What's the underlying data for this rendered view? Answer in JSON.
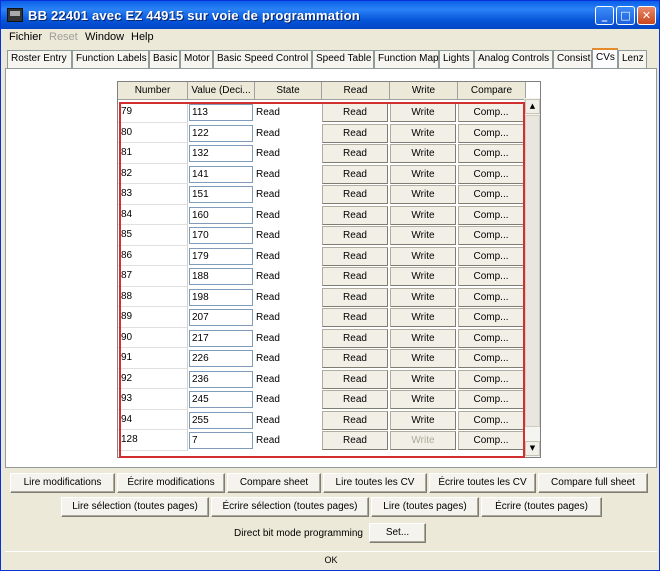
{
  "window": {
    "title": "BB 22401 avec EZ 44915 sur voie de programmation",
    "controls": {
      "minimize": "_",
      "maximize": "□",
      "close": "✕"
    },
    "icon": "locomotive-icon"
  },
  "menu": [
    {
      "label": "Fichier",
      "enabled": true
    },
    {
      "label": "Reset",
      "enabled": false
    },
    {
      "label": "Window",
      "enabled": true
    },
    {
      "label": "Help",
      "enabled": true
    }
  ],
  "tabs": [
    "Roster Entry",
    "Function Labels",
    "Basic",
    "Motor",
    "Basic Speed Control",
    "Speed Table",
    "Function Map",
    "Lights",
    "Analog Controls",
    "Consist",
    "CVs",
    "Lenz"
  ],
  "active_tab": "CVs",
  "grid": {
    "columns": [
      "Number",
      "Value (Deci...",
      "State",
      "Read",
      "Write",
      "Compare"
    ],
    "rows": [
      {
        "number": "79",
        "value": "113",
        "state": "Read",
        "write_enabled": true
      },
      {
        "number": "80",
        "value": "122",
        "state": "Read",
        "write_enabled": true
      },
      {
        "number": "81",
        "value": "132",
        "state": "Read",
        "write_enabled": true
      },
      {
        "number": "82",
        "value": "141",
        "state": "Read",
        "write_enabled": true
      },
      {
        "number": "83",
        "value": "151",
        "state": "Read",
        "write_enabled": true
      },
      {
        "number": "84",
        "value": "160",
        "state": "Read",
        "write_enabled": true
      },
      {
        "number": "85",
        "value": "170",
        "state": "Read",
        "write_enabled": true
      },
      {
        "number": "86",
        "value": "179",
        "state": "Read",
        "write_enabled": true
      },
      {
        "number": "87",
        "value": "188",
        "state": "Read",
        "write_enabled": true
      },
      {
        "number": "88",
        "value": "198",
        "state": "Read",
        "write_enabled": true
      },
      {
        "number": "89",
        "value": "207",
        "state": "Read",
        "write_enabled": true
      },
      {
        "number": "90",
        "value": "217",
        "state": "Read",
        "write_enabled": true
      },
      {
        "number": "91",
        "value": "226",
        "state": "Read",
        "write_enabled": true
      },
      {
        "number": "92",
        "value": "236",
        "state": "Read",
        "write_enabled": true
      },
      {
        "number": "93",
        "value": "245",
        "state": "Read",
        "write_enabled": true
      },
      {
        "number": "94",
        "value": "255",
        "state": "Read",
        "write_enabled": true
      },
      {
        "number": "128",
        "value": "7",
        "state": "Read",
        "write_enabled": false
      }
    ],
    "button_labels": {
      "read": "Read",
      "write": "Write",
      "compare": "Comp..."
    }
  },
  "actions_row1": [
    "Lire modifications",
    "Écrire modifications",
    "Compare sheet",
    "Lire toutes les CV",
    "Écrire toutes les CV",
    "Compare full sheet"
  ],
  "actions_row2": [
    "Lire sélection (toutes pages)",
    "Écrire sélection (toutes pages)",
    "Lire (toutes pages)",
    "Écrire (toutes pages)"
  ],
  "bit_mode": {
    "label": "Direct bit mode programming",
    "button": "Set..."
  },
  "status": "OK",
  "colors": {
    "selection_border": "#d23030",
    "titlebar": "#0454d8"
  }
}
